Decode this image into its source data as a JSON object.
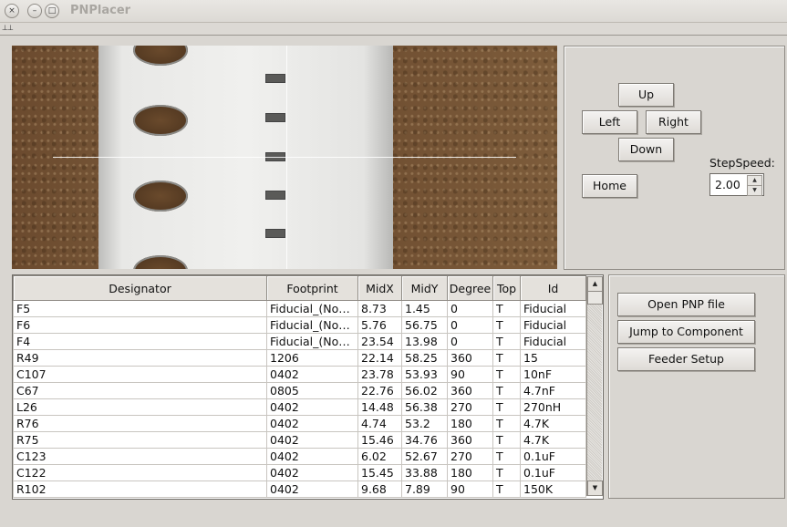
{
  "window": {
    "title": "PNPlacer",
    "close_glyph": "×",
    "min_glyph": "–",
    "max_glyph": "□",
    "tearoff_glyph": "⊥"
  },
  "jog": {
    "up": "Up",
    "left": "Left",
    "right": "Right",
    "down": "Down",
    "home": "Home",
    "step_label": "StepSpeed:",
    "step_value": "2.00"
  },
  "actions": {
    "open": "Open PNP file",
    "jump": "Jump to Component",
    "feeder": "Feeder Setup"
  },
  "table": {
    "columns": [
      "Designator",
      "Footprint",
      "MidX",
      "MidY",
      "Degree",
      "Top",
      "Id"
    ],
    "rows": [
      [
        "F5",
        "Fiducial_(No_...",
        "8.73",
        "1.45",
        "0",
        "T",
        "Fiducial"
      ],
      [
        "F6",
        "Fiducial_(No_...",
        "5.76",
        "56.75",
        "0",
        "T",
        "Fiducial"
      ],
      [
        "F4",
        "Fiducial_(No_...",
        "23.54",
        "13.98",
        "0",
        "T",
        "Fiducial"
      ],
      [
        "R49",
        "1206",
        "22.14",
        "58.25",
        "360",
        "T",
        "15"
      ],
      [
        "C107",
        "0402",
        "23.78",
        "53.93",
        "90",
        "T",
        "10nF"
      ],
      [
        "C67",
        "0805",
        "22.76",
        "56.02",
        "360",
        "T",
        "4.7nF"
      ],
      [
        "L26",
        "0402",
        "14.48",
        "56.38",
        "270",
        "T",
        "270nH"
      ],
      [
        "R76",
        "0402",
        "4.74",
        "53.2",
        "180",
        "T",
        "4.7K"
      ],
      [
        "R75",
        "0402",
        "15.46",
        "34.76",
        "360",
        "T",
        "4.7K"
      ],
      [
        "C123",
        "0402",
        "6.02",
        "52.67",
        "270",
        "T",
        "0.1uF"
      ],
      [
        "C122",
        "0402",
        "15.45",
        "33.88",
        "180",
        "T",
        "0.1uF"
      ],
      [
        "R102",
        "0402",
        "9.68",
        "7.89",
        "90",
        "T",
        "150K"
      ]
    ]
  },
  "scroll": {
    "up_glyph": "▲",
    "down_glyph": "▼"
  }
}
